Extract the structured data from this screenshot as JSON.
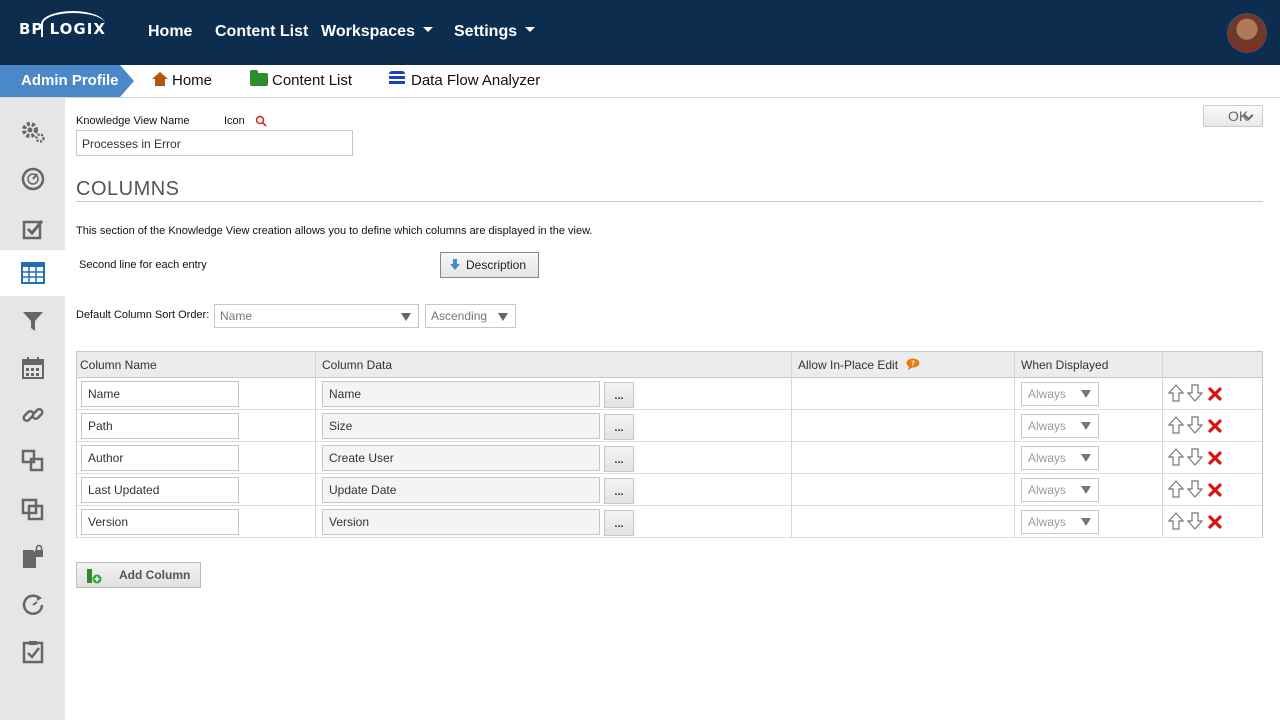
{
  "brand": {
    "logo_text": "BP LOGIX"
  },
  "topnav": {
    "home": "Home",
    "content_list": "Content List",
    "workspaces": "Workspaces",
    "settings": "Settings"
  },
  "breadcrumb": {
    "active": "Admin Profile",
    "home": "Home",
    "content_list": "Content List",
    "data_flow": "Data Flow Analyzer"
  },
  "rail": {
    "items": [
      "gears-icon",
      "dashboard-icon",
      "checkbox-icon",
      "table-icon",
      "filter-icon",
      "calendar-icon",
      "link-icon",
      "copy-icon",
      "duplicate-icon",
      "locked-file-icon",
      "refresh-icon",
      "task-icon"
    ],
    "active_index": 3
  },
  "form": {
    "kv_name_label": "Knowledge View Name",
    "icon_label": "Icon",
    "kv_name_value": "Processes in Error",
    "ok_label": "OK",
    "section_title": "COLUMNS",
    "section_desc": "This section of the Knowledge View creation allows you to define which columns are displayed in the view.",
    "second_line_label": "Second line for each entry",
    "description_button": "Description",
    "sort_label": "Default Column Sort Order:",
    "sort_field": "Name",
    "sort_direction": "Ascending"
  },
  "table": {
    "headers": {
      "col_name": "Column Name",
      "col_data": "Column Data",
      "in_place": "Allow In-Place Edit",
      "when": "When Displayed"
    },
    "rows": [
      {
        "name": "Name",
        "data": "Name",
        "when": "Always"
      },
      {
        "name": "Path",
        "data": "Size",
        "when": "Always"
      },
      {
        "name": "Author",
        "data": "Create User",
        "when": "Always"
      },
      {
        "name": "Last Updated",
        "data": "Update Date",
        "when": "Always"
      },
      {
        "name": "Version",
        "data": "Version",
        "when": "Always"
      }
    ],
    "dots_label": "..."
  },
  "add_column_label": "Add Column",
  "colors": {
    "nav_bg": "#0c2d4e",
    "crumb_active": "#4a88c8",
    "delete_red": "#d41414"
  }
}
